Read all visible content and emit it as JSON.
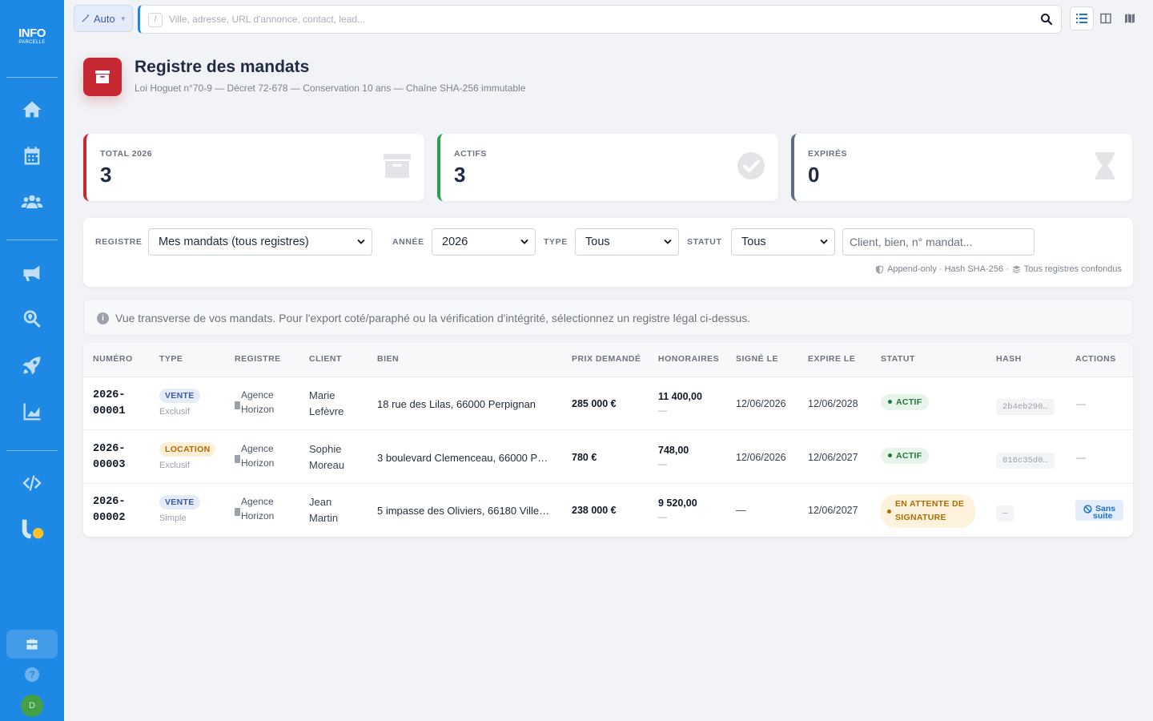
{
  "sidebar": {
    "logo_main": "INFO",
    "logo_sub": "PARCELLE",
    "avatar_initial": "D",
    "help_label": "?"
  },
  "topbar": {
    "mode_label": "Auto",
    "slash_key": "/",
    "search_placeholder": "Ville, adresse, URL d'annonce, contact, lead..."
  },
  "header": {
    "title": "Registre des mandats",
    "subtitle": "Loi Hoguet n°70-9 — Décret 72-678 — Conservation 10 ans — Chaîne SHA-256 immutable"
  },
  "stats": [
    {
      "label": "TOTAL 2026",
      "value": "3",
      "color": "#c62834"
    },
    {
      "label": "ACTIFS",
      "value": "3",
      "color": "#2e9e4f"
    },
    {
      "label": "EXPIRÉS",
      "value": "0",
      "color": "#5f6b80"
    }
  ],
  "filters": {
    "registre_label": "REGISTRE",
    "registre_value": "Mes mandats (tous registres)",
    "annee_label": "ANNÉE",
    "annee_value": "2026",
    "type_label": "TYPE",
    "type_value": "Tous",
    "statut_label": "STATUT",
    "statut_value": "Tous",
    "search_placeholder": "Client, bien, n° mandat...",
    "footer_1": "Append-only · Hash SHA-256 ·",
    "footer_2": "Tous registres confondus"
  },
  "info_banner": "Vue transverse de vos mandats. Pour l'export coté/paraphé ou la vérification d'intégrité, sélectionnez un registre légal ci-dessus.",
  "table": {
    "headers": [
      "NUMÉRO",
      "TYPE",
      "REGISTRE",
      "CLIENT",
      "BIEN",
      "PRIX DEMANDÉ",
      "HONORAIRES",
      "SIGNÉ LE",
      "EXPIRE LE",
      "STATUT",
      "HASH",
      "ACTIONS"
    ],
    "rows": [
      {
        "num_1": "2026-",
        "num_2": "00001",
        "type": "VENTE",
        "type_sub": "Exclusif",
        "reg_1": "Agence",
        "reg_2": "Horizon",
        "client_1": "Marie",
        "client_2": "Lefèvre",
        "bien": "18 rue des Lilas, 66000 Perpignan",
        "prix": "285 000 €",
        "honoraires": "11 400,00",
        "hon_sub": "—",
        "signe": "12/06/2026",
        "expire": "12/06/2028",
        "statut": "ACTIF",
        "hash": "2b4eb290…",
        "action": "—"
      },
      {
        "num_1": "2026-",
        "num_2": "00003",
        "type": "LOCATION",
        "type_sub": "Exclusif",
        "reg_1": "Agence",
        "reg_2": "Horizon",
        "client_1": "Sophie",
        "client_2": "Moreau",
        "bien": "3 boulevard Clemenceau, 66000 P…",
        "prix": "780 €",
        "honoraires": "748,00",
        "hon_sub": "—",
        "signe": "12/06/2026",
        "expire": "12/06/2027",
        "statut": "ACTIF",
        "hash": "016c35d0…",
        "action": "—"
      },
      {
        "num_1": "2026-",
        "num_2": "00002",
        "type": "VENTE",
        "type_sub": "Simple",
        "reg_1": "Agence",
        "reg_2": "Horizon",
        "client_1": "Jean",
        "client_2": "Martin",
        "bien": "5 impasse des Oliviers, 66180 Ville…",
        "prix": "238 000 €",
        "honoraires": "9 520,00",
        "hon_sub": "—",
        "signe": "—",
        "expire": "12/06/2027",
        "statut_1": "EN ATTENTE DE",
        "statut_2": "SIGNATURE",
        "hash": "—",
        "action_1": "Sans",
        "action_2": "suite"
      }
    ]
  }
}
